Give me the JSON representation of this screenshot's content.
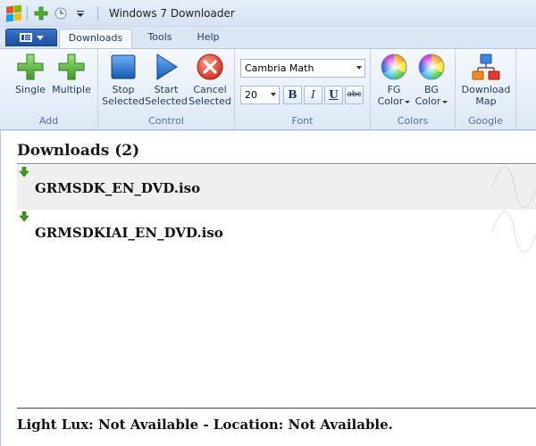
{
  "window": {
    "title": "Windows 7 Downloader"
  },
  "tabs": [
    {
      "label": "Downloads",
      "active": true
    },
    {
      "label": "Tools",
      "active": false
    },
    {
      "label": "Help",
      "active": false
    }
  ],
  "ribbon": {
    "add_group": {
      "label": "Add",
      "single": "Single",
      "multiple": "Multiple"
    },
    "control_group": {
      "label": "Control",
      "stop_line1": "Stop",
      "stop_line2": "Selected",
      "start_line1": "Start",
      "start_line2": "Selected",
      "cancel_line1": "Cancel",
      "cancel_line2": "Selected"
    },
    "font_group": {
      "label": "Font",
      "family": "Cambria Math",
      "size": "20",
      "bold": "B",
      "italic": "I",
      "underline": "U",
      "strike": "abc"
    },
    "colors_group": {
      "label": "Colors",
      "fg_line1": "FG",
      "fg_line2": "Color",
      "bg_line1": "BG",
      "bg_line2": "Color"
    },
    "google_group": {
      "label": "Google",
      "map_line1": "Download",
      "map_line2": "Map"
    }
  },
  "downloads": {
    "title": "Downloads (2)",
    "items": [
      {
        "name": "GRMSDK_EN_DVD.iso",
        "selected": true
      },
      {
        "name": "GRMSDKIAI_EN_DVD.iso",
        "selected": false
      }
    ]
  },
  "status": {
    "text": "Light Lux: Not Available - Location: Not Available."
  },
  "colors": {
    "accent": "#1f4f9e",
    "ribbon_bg": "#dde8f6",
    "add_green": "#4caf32",
    "stop_blue": "#1e6fd0",
    "cancel_red": "#e03a2a"
  }
}
